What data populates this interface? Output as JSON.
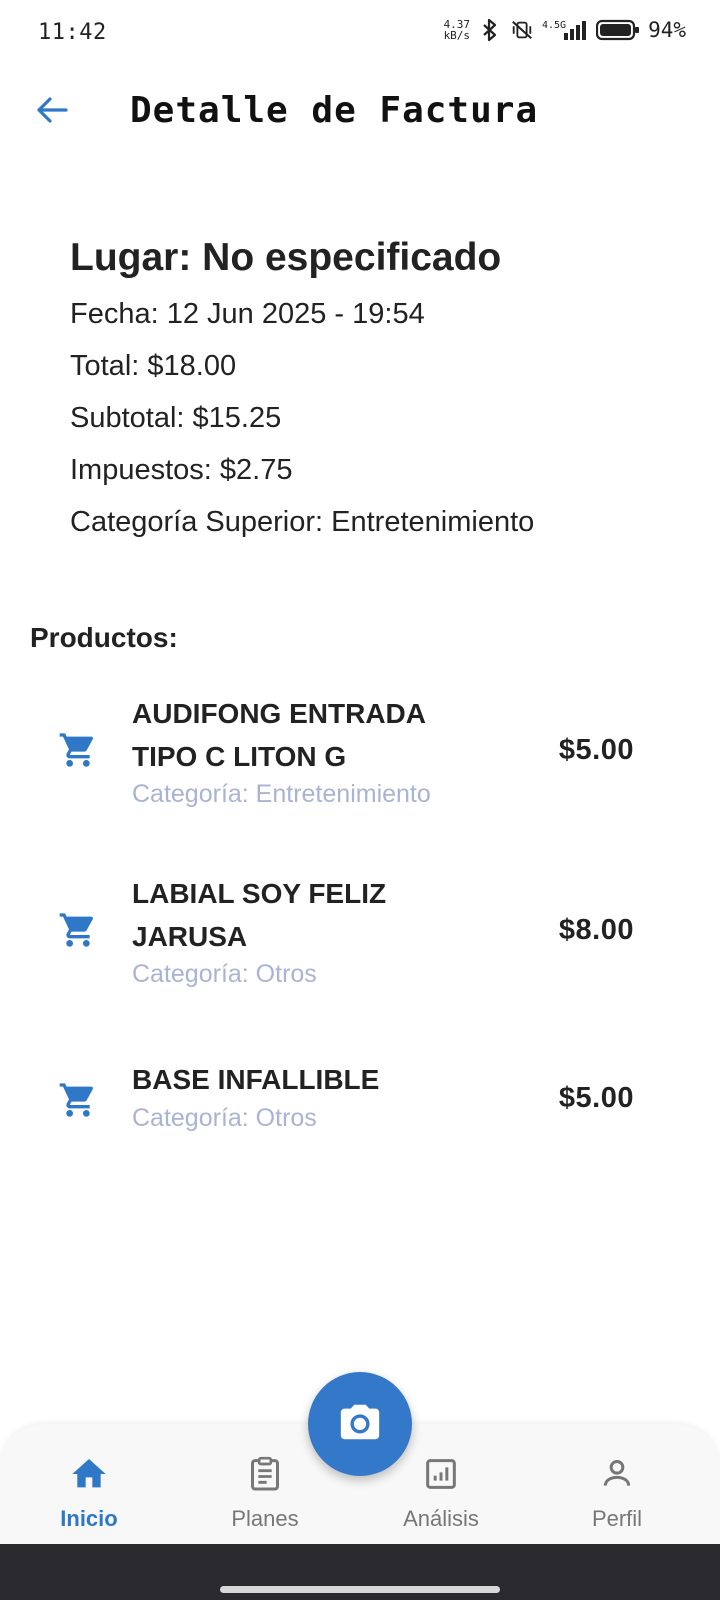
{
  "status_bar": {
    "time": "11:42",
    "net_speed_value": "4.37",
    "net_speed_unit": "kB/s",
    "network_label": "4.5G",
    "battery_pct": "94%"
  },
  "app_bar": {
    "title": "Detalle de Factura",
    "back_icon": "arrow-left-icon"
  },
  "invoice": {
    "place": "Lugar: No especificado",
    "date": "Fecha: 12 Jun 2025 - 19:54",
    "total": "Total: $18.00",
    "subtotal": "Subtotal: $15.25",
    "taxes": "Impuestos: $2.75",
    "top_category": "Categoría Superior: Entretenimiento"
  },
  "products": {
    "heading": "Productos:",
    "items": [
      {
        "name": "AUDIFONG ENTRADA TIPO C LITON G",
        "category": "Categoría: Entretenimiento",
        "price": "$5.00"
      },
      {
        "name": "LABIAL SOY FELIZ JARUSA",
        "category": "Categoría: Otros",
        "price": "$8.00"
      },
      {
        "name": "BASE INFALLIBLE",
        "category": "Categoría: Otros",
        "price": "$5.00"
      }
    ]
  },
  "bottom_nav": {
    "items": [
      {
        "label": "Inicio",
        "icon": "home-icon",
        "active": true
      },
      {
        "label": "Planes",
        "icon": "clipboard-icon",
        "active": false
      },
      {
        "label": "Análisis",
        "icon": "bar-chart-icon",
        "active": false
      },
      {
        "label": "Perfil",
        "icon": "person-icon",
        "active": false
      }
    ],
    "fab_icon": "camera-icon"
  },
  "colors": {
    "accent": "#3479c9",
    "category_text": "#aab4d2",
    "text": "#222222",
    "nav_background": "#f8f8f9"
  }
}
